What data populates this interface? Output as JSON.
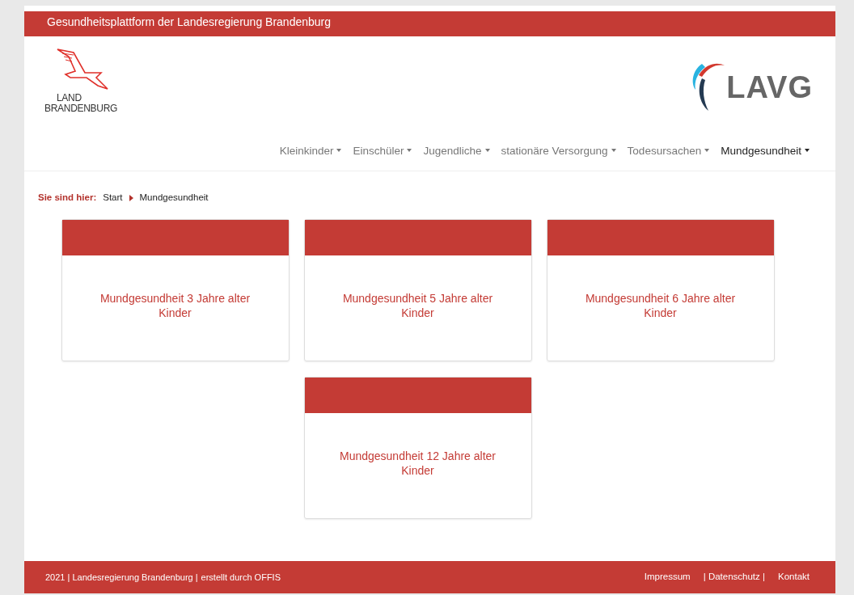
{
  "top_bar": {
    "title": "Gesundheitsplattform der Landesregierung Brandenburg"
  },
  "logo_left": {
    "line1": "LAND",
    "line2": "BRANDENBURG"
  },
  "logo_right": {
    "text": "LAVG"
  },
  "nav": [
    {
      "label": "Kleinkinder",
      "selected": false
    },
    {
      "label": "Einschüler",
      "selected": false
    },
    {
      "label": "Jugendliche",
      "selected": false
    },
    {
      "label": "stationäre Versorgung",
      "selected": false
    },
    {
      "label": "Todesursachen",
      "selected": false
    },
    {
      "label": "Mundgesundheit",
      "selected": true
    }
  ],
  "breadcrumb": {
    "label": "Sie sind hier:",
    "items": [
      "Start",
      "Mundgesundheit"
    ]
  },
  "cards": [
    {
      "title": "Mundgesundheit 3 Jahre alter Kinder"
    },
    {
      "title": "Mundgesundheit 5 Jahre alter Kinder"
    },
    {
      "title": "Mundgesundheit 6 Jahre alter Kinder"
    },
    {
      "title": "Mundgesundheit 12 Jahre alter Kinder"
    }
  ],
  "footer": {
    "left": [
      "2021 | Landesregierung Brandenburg |",
      "erstellt durch OFFIS"
    ],
    "right": [
      "Impressum",
      "| Datenschutz |",
      "Kontakt"
    ]
  }
}
